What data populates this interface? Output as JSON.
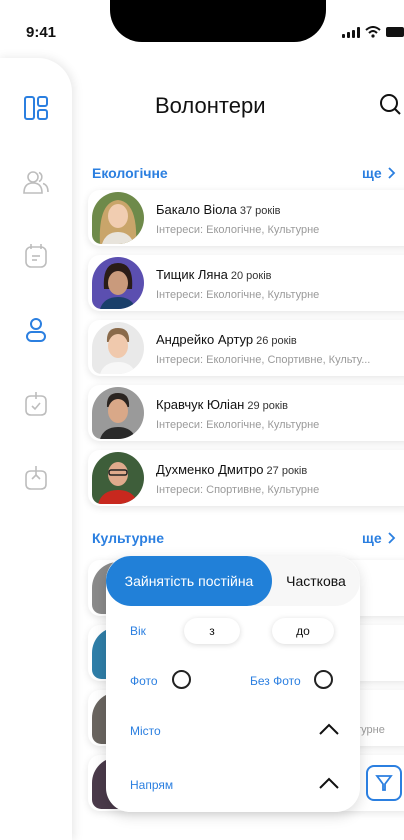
{
  "status_bar": {
    "time": "9:41"
  },
  "header": {
    "title": "Волонтери"
  },
  "sections": [
    {
      "title": "Екологічне",
      "more": "ще"
    },
    {
      "title": "Культурне",
      "more": "ще"
    }
  ],
  "volunteers": [
    {
      "name": "Бакало Віола",
      "age": "37 років",
      "interests": "Інтереси: Екологічне, Культурне"
    },
    {
      "name": "Тищик Ляна",
      "age": "20 років",
      "interests": "Інтереси: Екологічне, Культурне"
    },
    {
      "name": "Андрейко Артур",
      "age": "26 років",
      "interests": "Інтереси: Екологічне, Спортивне, Культу..."
    },
    {
      "name": "Кравчук Юліан",
      "age": "29 років",
      "interests": "Інтереси: Екологічне, Культурне"
    },
    {
      "name": "Духменко Дмитро",
      "age": "27 років",
      "interests": "Інтереси: Спортивне, Культурне"
    }
  ],
  "hidden_card_text": "турне",
  "filter": {
    "employment_active": "Зайнятість постійна",
    "employment_other": "Часткова",
    "age_label": "Вік",
    "age_from": "з",
    "age_to": "до",
    "photo_label": "Фото",
    "no_photo_label": "Без Фото",
    "city_label": "Місто",
    "direction_label": "Напрям"
  },
  "colors": {
    "accent": "#2180d8",
    "link": "#2b7fe0"
  },
  "icons": [
    "dashboard-icon",
    "users-icon",
    "calendar-icon",
    "person-icon",
    "calendar-check-icon",
    "calendar-upload-icon",
    "search-icon",
    "chevron-right-icon",
    "chevron-up-icon",
    "filter-icon"
  ]
}
